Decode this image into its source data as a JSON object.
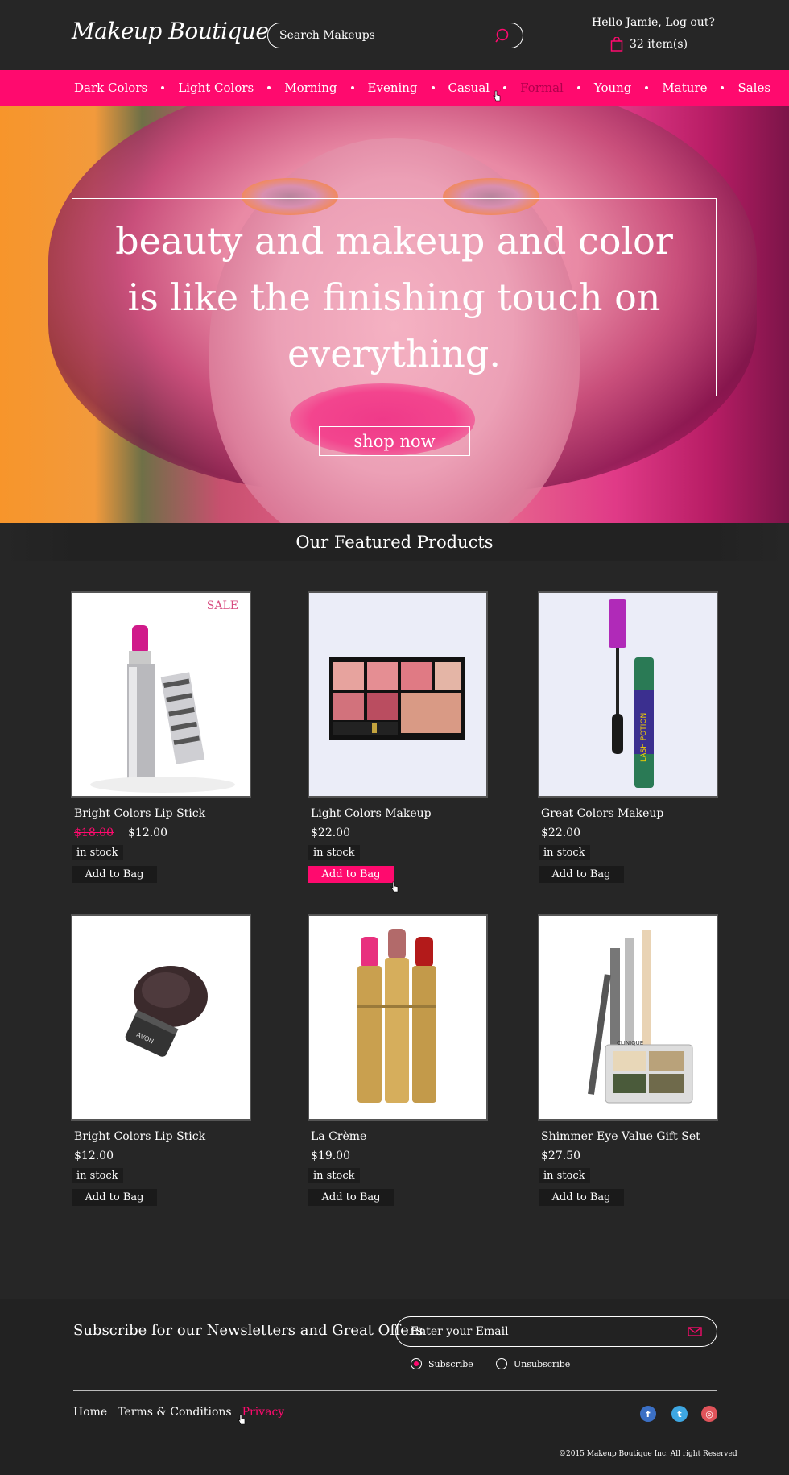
{
  "header": {
    "logo": "Makeup Boutique",
    "search_placeholder": "Search Makeups",
    "greeting": "Hello Jamie, Log out?",
    "cart": "32 item(s)"
  },
  "nav": [
    {
      "label": "Dark Colors"
    },
    {
      "label": "Light Colors"
    },
    {
      "label": "Morning"
    },
    {
      "label": "Evening"
    },
    {
      "label": "Casual"
    },
    {
      "label": "Formal"
    },
    {
      "label": "Young"
    },
    {
      "label": "Mature"
    },
    {
      "label": "Sales"
    }
  ],
  "hero": {
    "quote": "beauty and makeup and color is like the finishing touch on everything.",
    "cta": "shop now"
  },
  "featured": {
    "title": "Our Featured Products",
    "sale_badge": "SALE"
  },
  "products": [
    {
      "name": "Bright Colors Lip Stick",
      "old_price": "$18.00",
      "price": "$12.00",
      "stock": "in stock",
      "cta": "Add to Bag"
    },
    {
      "name": "Light Colors Makeup",
      "price": "$22.00",
      "stock": "in stock",
      "cta": "Add to Bag"
    },
    {
      "name": "Great Colors Makeup",
      "price": "$22.00",
      "stock": "in stock",
      "cta": "Add to Bag"
    },
    {
      "name": "Bright Colors Lip Stick",
      "price": "$12.00",
      "stock": "in stock",
      "cta": "Add to Bag"
    },
    {
      "name": "La Crème",
      "price": "$19.00",
      "stock": "in stock",
      "cta": "Add to Bag"
    },
    {
      "name": "Shimmer Eye Value Gift Set",
      "price": "$27.50",
      "stock": "in stock",
      "cta": "Add to Bag"
    }
  ],
  "product_labels": {
    "mascara": "LASH POTION",
    "brush": "AVON",
    "clinique": "CLINIQUE"
  },
  "newsletter": {
    "title": "Subscribe for our Newsletters and Great Offers",
    "email_placeholder": "Enter your Email",
    "subscribe": "Subscribe",
    "unsubscribe": "Unsubscribe"
  },
  "footer": {
    "links": [
      "Home",
      "Terms & Conditions",
      "Privacy"
    ],
    "copyright": "©2015 Makeup Boutique Inc. All right Reserved"
  },
  "colors": {
    "accent": "#ff0a6e",
    "background": "#262626"
  }
}
